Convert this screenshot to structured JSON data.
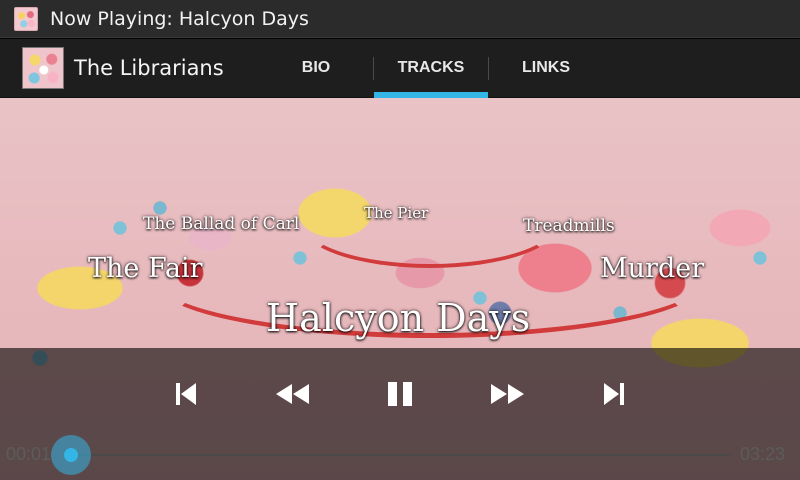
{
  "window": {
    "title": "Now Playing: Halcyon Days",
    "app_icon": "album-art-icon"
  },
  "actionbar": {
    "artist": "The Librarians",
    "tabs": [
      {
        "label": "BIO",
        "active": false
      },
      {
        "label": "TRACKS",
        "active": true
      },
      {
        "label": "LINKS",
        "active": false
      }
    ]
  },
  "tracks": {
    "ballad_of_carl": "The Ballad of Carl",
    "the_pier": "The Pier",
    "treadmills": "Treadmills",
    "the_fair": "The Fair",
    "murder": "Murder",
    "now_playing": "Halcyon Days"
  },
  "player": {
    "elapsed": "00:01",
    "duration": "03:23",
    "progress_fraction": 0.005,
    "state": "playing",
    "icons": {
      "previous": "skip-previous-icon",
      "rewind": "rewind-icon",
      "pause": "pause-icon",
      "fast_forward": "fast-forward-icon",
      "next": "skip-next-icon"
    }
  },
  "colors": {
    "accent": "#33b5e5",
    "titlebar_bg": "#2b2b2b",
    "actionbar_bg": "#1e1e1e"
  }
}
